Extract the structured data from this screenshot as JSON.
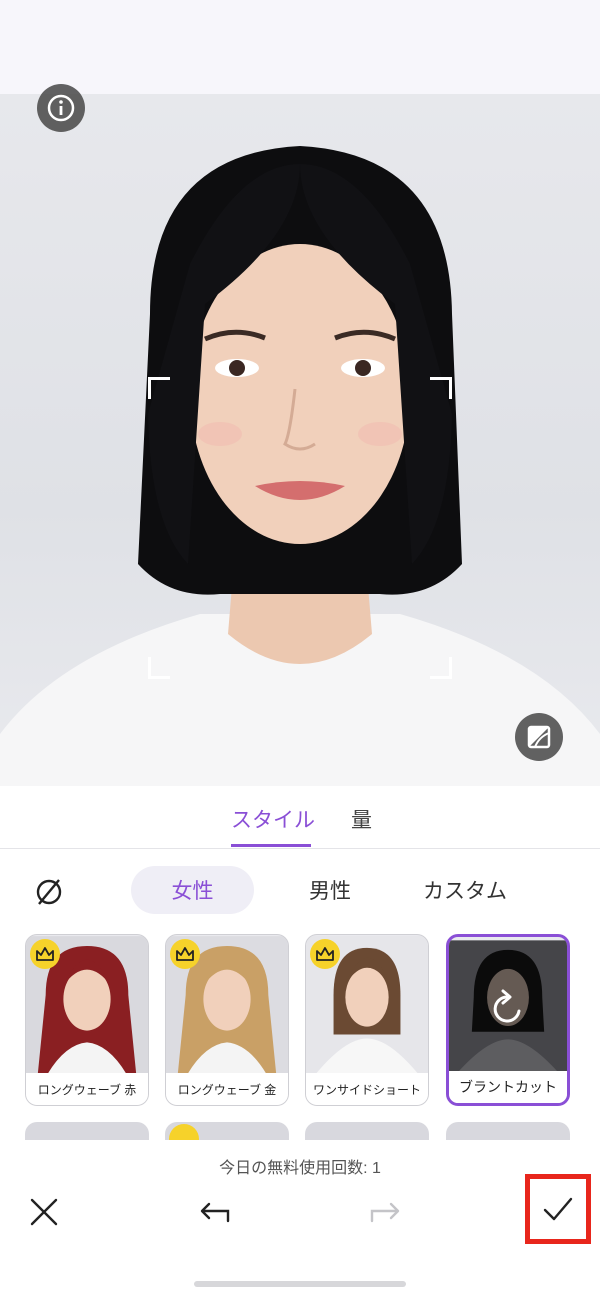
{
  "photo": {
    "info_icon": "info-icon",
    "compare_icon": "compare-icon"
  },
  "tabs": [
    {
      "label": "スタイル",
      "active": true
    },
    {
      "label": "量",
      "active": false
    }
  ],
  "categories": {
    "none_icon": "none-icon",
    "items": [
      {
        "label": "女性",
        "active": true
      },
      {
        "label": "男性",
        "active": false
      },
      {
        "label": "カスタム",
        "active": false
      }
    ]
  },
  "styles": [
    {
      "label": "ロングウェーブ 赤",
      "premium": true,
      "hair_color": "#8a1f22"
    },
    {
      "label": "ロングウェーブ 金",
      "premium": true,
      "hair_color": "#c9a066"
    },
    {
      "label": "ワンサイドショート",
      "premium": true,
      "hair_color": "#6b4a33"
    },
    {
      "label": "ブラントカット",
      "premium": false,
      "selected": true,
      "hair_color": "#111111"
    }
  ],
  "footer": {
    "free_count": "今日の無料使用回数: 1",
    "close_icon": "close-icon",
    "undo_icon": "undo-icon",
    "redo_icon": "redo-icon",
    "confirm_icon": "check-icon"
  },
  "colors": {
    "accent": "#8a4fd6",
    "highlight_box": "#e8261c",
    "crown": "#f6d22a"
  }
}
